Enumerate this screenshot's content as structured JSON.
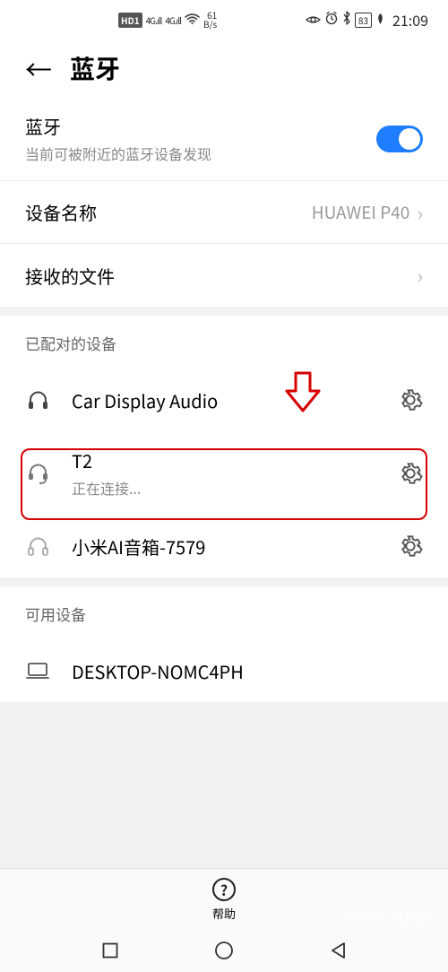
{
  "status": {
    "hd": "HD1",
    "signal1": "4G",
    "signal2": "4G",
    "speed": "61",
    "speed_unit": "B/s",
    "battery": "83",
    "time": "21:09"
  },
  "header": {
    "title": "蓝牙"
  },
  "bluetooth": {
    "name_label": "蓝牙",
    "sub_label": "当前可被附近的蓝牙设备发现",
    "on": true
  },
  "rows": {
    "device_name_label": "设备名称",
    "device_name_value": "HUAWEI P40",
    "received_files_label": "接收的文件"
  },
  "groups": {
    "paired_title": "已配对的设备",
    "available_title": "可用设备"
  },
  "devices": {
    "paired": [
      {
        "name": "Car Display Audio"
      },
      {
        "name": "T2",
        "status": "正在连接..."
      },
      {
        "name": "小米AI音箱-7579"
      }
    ],
    "available": [
      {
        "name": "DESKTOP-NOMC4PH"
      }
    ]
  },
  "help_label": "帮助",
  "watermark": "Baidu经验"
}
